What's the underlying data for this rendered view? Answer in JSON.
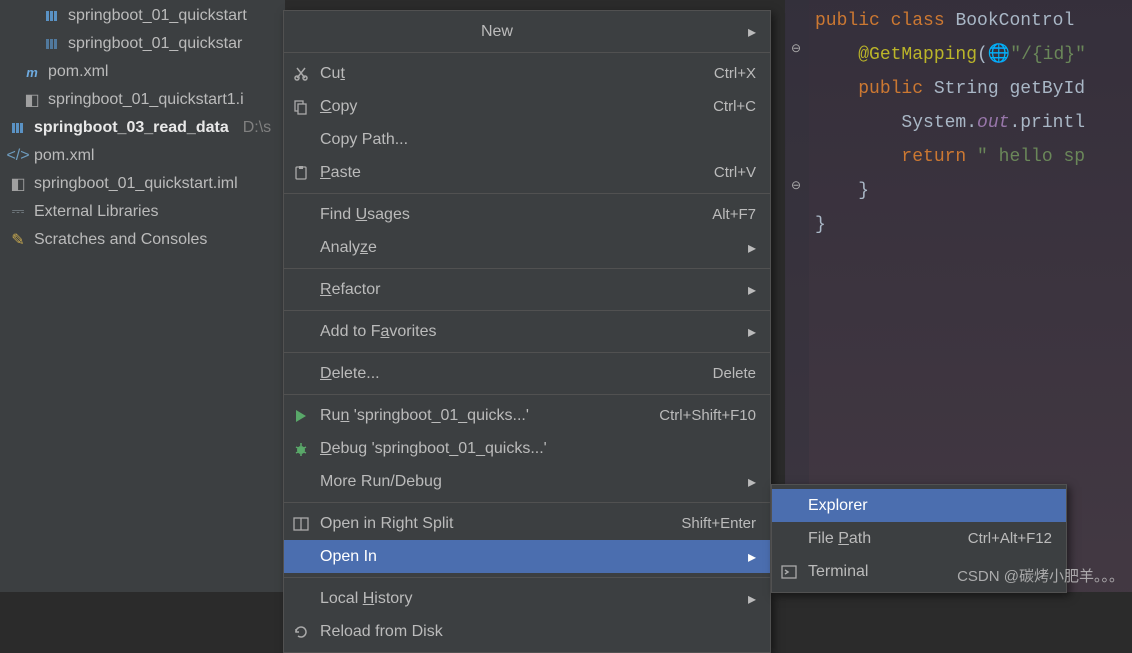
{
  "tree": {
    "items": [
      {
        "icon": "folder",
        "label": "springboot_01_quickstart",
        "indent": 34
      },
      {
        "icon": "folder",
        "label": "springboot_01_quickstar",
        "indent": 34,
        "dim": true
      },
      {
        "icon": "pom",
        "label": "pom.xml",
        "indent": 14
      },
      {
        "icon": "iml",
        "label": "springboot_01_quickstart1.i",
        "indent": 14
      },
      {
        "icon": "folder",
        "label": "springboot_03_read_data",
        "path": "D:\\s",
        "indent": 0,
        "bold": true
      },
      {
        "icon": "xml",
        "label": "pom.xml",
        "indent": 0
      },
      {
        "icon": "iml",
        "label": "springboot_01_quickstart.iml",
        "indent": 0
      },
      {
        "icon": "lib",
        "label": "External Libraries",
        "indent": 0
      },
      {
        "icon": "scratch",
        "label": "Scratches and Consoles",
        "indent": 0
      }
    ]
  },
  "contextMenu": {
    "items": [
      {
        "label": "New",
        "centered": true,
        "submenu": true
      },
      {
        "icon": "cut",
        "label_html": "Cu<u>t</u>",
        "shortcut": "Ctrl+X"
      },
      {
        "icon": "copy",
        "label_html": "<u>C</u>opy",
        "shortcut": "Ctrl+C"
      },
      {
        "label": "Copy Path...",
        "indent": true
      },
      {
        "icon": "paste",
        "label_html": "<u>P</u>aste",
        "shortcut": "Ctrl+V"
      },
      {
        "label_html": "Find <u>U</u>sages",
        "shortcut": "Alt+F7",
        "indent": true
      },
      {
        "label_html": "Analy<u>z</u>e",
        "submenu": true,
        "indent": true
      },
      {
        "label_html": "<u>R</u>efactor",
        "submenu": true,
        "indent": true
      },
      {
        "label_html": "Add to F<u>a</u>vorites",
        "submenu": true,
        "indent": true
      },
      {
        "label_html": "<u>D</u>elete...",
        "shortcut": "Delete",
        "indent": true
      },
      {
        "icon": "run",
        "label_html": "Ru<u>n</u> 'springboot_01_quicks...'",
        "shortcut": "Ctrl+Shift+F10"
      },
      {
        "icon": "debug",
        "label_html": "<u>D</u>ebug 'springboot_01_quicks...'"
      },
      {
        "label": "More Run/Debug",
        "submenu": true,
        "indent": true
      },
      {
        "icon": "split",
        "label": "Open in Right Split",
        "shortcut": "Shift+Enter"
      },
      {
        "label": "Open In",
        "submenu": true,
        "indent": true,
        "hover": true
      },
      {
        "label_html": "Local <u>H</u>istory",
        "submenu": true,
        "indent": true
      },
      {
        "icon": "reload",
        "label": "Reload from Disk"
      }
    ],
    "separators_after": [
      0,
      4,
      6,
      7,
      8,
      9,
      12,
      14
    ]
  },
  "submenu": {
    "items": [
      {
        "label": "Explorer",
        "hover": true,
        "indent": true
      },
      {
        "label_html": "File <u>P</u>ath",
        "shortcut": "Ctrl+Alt+F12",
        "indent": true
      },
      {
        "icon": "terminal",
        "label": "Terminal"
      }
    ]
  },
  "code": {
    "line1_pre": "public class ",
    "line1_name": "BookControl",
    "line2_anno": "@GetMapping",
    "line2_arg": "\"/{id}\"",
    "line3_public": "public ",
    "line3_type": "String ",
    "line3_method": "getById",
    "line4_a": "System.",
    "line4_b": "out",
    "line4_c": ".printl",
    "line5_ret": "return ",
    "line5_str": "\" hello sp",
    "line6": "}",
    "line7": "}"
  },
  "watermark": "CSDN @碳烤小肥羊。。。"
}
